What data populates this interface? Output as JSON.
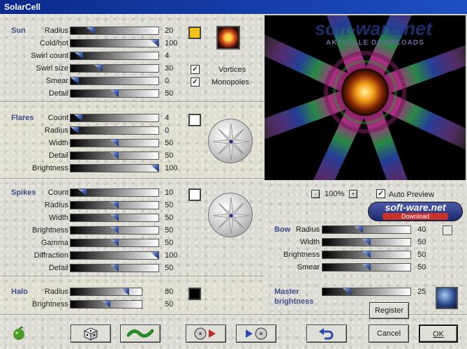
{
  "window": {
    "title": "SolarCell"
  },
  "colors": {
    "accent": "#3d4f8c",
    "sun_swatch": "#f2c21a",
    "halo_swatch": "#000000"
  },
  "sun": {
    "title": "Sun",
    "rows": [
      {
        "label": "Radius",
        "value": "20",
        "level": 0.2
      },
      {
        "label": "Cold/hot",
        "value": "100",
        "level": 1.0
      },
      {
        "label": "Swirl count",
        "value": "4",
        "level": 0.05
      },
      {
        "label": "Swirl size",
        "value": "30",
        "level": 0.3
      },
      {
        "label": "Smear",
        "value": "0",
        "level": 0.0
      },
      {
        "label": "Detail",
        "value": "50",
        "level": 0.5
      }
    ],
    "vortices_label": "Vortices",
    "monopoles_label": "Monopoles",
    "vortices_checked": true,
    "monopoles_checked": true
  },
  "flares": {
    "title": "Flares",
    "rows": [
      {
        "label": "Count",
        "value": "4",
        "level": 0.04
      },
      {
        "label": "Radius",
        "value": "0",
        "level": 0.0
      },
      {
        "label": "Width",
        "value": "50",
        "level": 0.5
      },
      {
        "label": "Detail",
        "value": "50",
        "level": 0.5
      },
      {
        "label": "Brightness",
        "value": "100",
        "level": 1.0
      }
    ]
  },
  "spikes": {
    "title": "Spikes",
    "rows": [
      {
        "label": "Count",
        "value": "10",
        "level": 0.1
      },
      {
        "label": "Radius",
        "value": "50",
        "level": 0.5
      },
      {
        "label": "Width",
        "value": "50",
        "level": 0.5
      },
      {
        "label": "Brightness",
        "value": "50",
        "level": 0.5
      },
      {
        "label": "Gamma",
        "value": "50",
        "level": 0.5
      },
      {
        "label": "Diffraction",
        "value": "100",
        "level": 1.0
      },
      {
        "label": "Detail",
        "value": "50",
        "level": 0.5
      }
    ]
  },
  "halo": {
    "title": "Halo",
    "rows": [
      {
        "label": "Radius",
        "value": "80",
        "level": 0.8
      },
      {
        "label": "Brightness",
        "value": "50",
        "level": 0.5
      }
    ]
  },
  "bow": {
    "title": "Bow",
    "rows": [
      {
        "label": "Radius",
        "value": "40",
        "level": 0.4
      },
      {
        "label": "Width",
        "value": "50",
        "level": 0.5
      },
      {
        "label": "Brightness",
        "value": "50",
        "level": 0.5
      },
      {
        "label": "Smear",
        "value": "50",
        "level": 0.5
      }
    ]
  },
  "master": {
    "title_line1": "Master",
    "title_line2": "brightness",
    "value": "25",
    "level": 0.25
  },
  "preview": {
    "zoom_minus": "-",
    "zoom": "100%",
    "zoom_plus": "+",
    "auto_preview_label": "Auto Preview",
    "auto_preview_checked": true,
    "watermark_top": "soft-ware.net",
    "watermark_sub": "AKTUELLE DOWNLOADS",
    "badge_title": "soft-ware.net",
    "badge_sub": "Download"
  },
  "buttons": {
    "register": "Register",
    "cancel": "Cancel",
    "ok": "OK"
  },
  "icons": {
    "app_logo": "apple-logo-icon",
    "random": "dice-icon",
    "wave": "wave-icon",
    "load": "load-preset-icon",
    "save": "save-preset-icon",
    "undo": "undo-icon",
    "sphere": "sphere-thumbnail-icon",
    "sun_thumb": "sun-thumbnail-icon"
  }
}
